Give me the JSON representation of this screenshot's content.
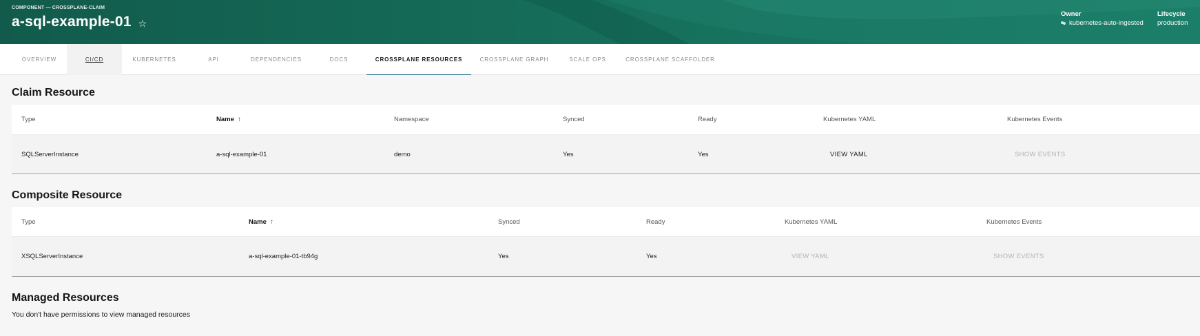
{
  "header": {
    "kicker": "COMPONENT — CROSSPLANE-CLAIM",
    "title": "a-sql-example-01",
    "owner_label": "Owner",
    "owner_value": "kubernetes-auto-ingested",
    "lifecycle_label": "Lifecycle",
    "lifecycle_value": "production",
    "star_icon": "star-outline-icon"
  },
  "tabs": [
    {
      "label": "OVERVIEW"
    },
    {
      "label": "CI/CD"
    },
    {
      "label": "KUBERNETES"
    },
    {
      "label": "API"
    },
    {
      "label": "DEPENDENCIES"
    },
    {
      "label": "DOCS"
    },
    {
      "label": "CROSSPLANE RESOURCES"
    },
    {
      "label": "CROSSPLANE GRAPH"
    },
    {
      "label": "SCALE OPS"
    },
    {
      "label": "CROSSPLANE SCAFFOLDER"
    }
  ],
  "active_tab": "CROSSPLANE RESOURCES",
  "claim": {
    "title": "Claim Resource",
    "columns": [
      "Type",
      "Name",
      "Namespace",
      "Synced",
      "Ready",
      "Kubernetes YAML",
      "Kubernetes Events"
    ],
    "row": {
      "type": "SQLServerInstance",
      "name": "a-sql-example-01",
      "namespace": "demo",
      "synced": "Yes",
      "ready": "Yes",
      "yaml": "VIEW YAML",
      "events": "SHOW EVENTS"
    }
  },
  "composite": {
    "title": "Composite Resource",
    "columns": [
      "Type",
      "Name",
      "Synced",
      "Ready",
      "Kubernetes YAML",
      "Kubernetes Events"
    ],
    "row": {
      "type": "XSQLServerInstance",
      "name": "a-sql-example-01-tb94g",
      "synced": "Yes",
      "ready": "Yes",
      "yaml": "VIEW YAML",
      "events": "SHOW EVENTS"
    }
  },
  "managed": {
    "title": "Managed Resources",
    "message": "You don't have permissions to view managed resources"
  },
  "colors": {
    "header_bg": "#16705c",
    "active_tab_indicator": "#1f6a85"
  }
}
